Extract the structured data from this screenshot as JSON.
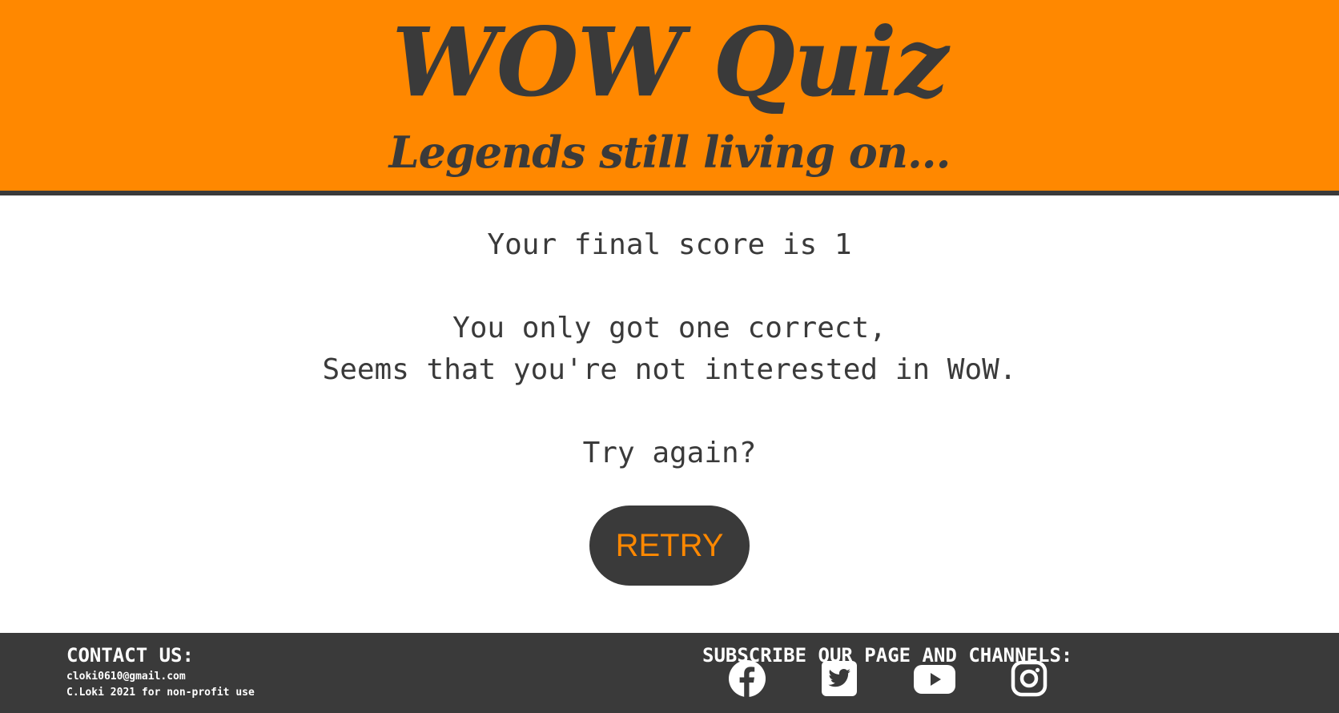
{
  "header": {
    "title": "WOW Quiz",
    "subtitle": "Legends still living on..."
  },
  "result": {
    "score_text": "Your final score is 1",
    "message_line_1": "You only got one correct,",
    "message_line_2": "Seems that you're not interested in WoW.",
    "prompt": "Try again?",
    "retry_label": "RETRY"
  },
  "footer": {
    "contact_heading": "CONTACT US:",
    "email": "cloki0610@gmail.com",
    "copyright": "C.Loki 2021 for non-profit use",
    "subscribe_heading": "SUBSCRIBE OUR PAGE AND CHANNELS:",
    "social_icons": [
      "facebook-icon",
      "twitter-icon",
      "youtube-icon",
      "instagram-icon"
    ]
  },
  "colors": {
    "accent": "#ff8800",
    "dark": "#3a3a3a",
    "background": "#ffffff"
  }
}
